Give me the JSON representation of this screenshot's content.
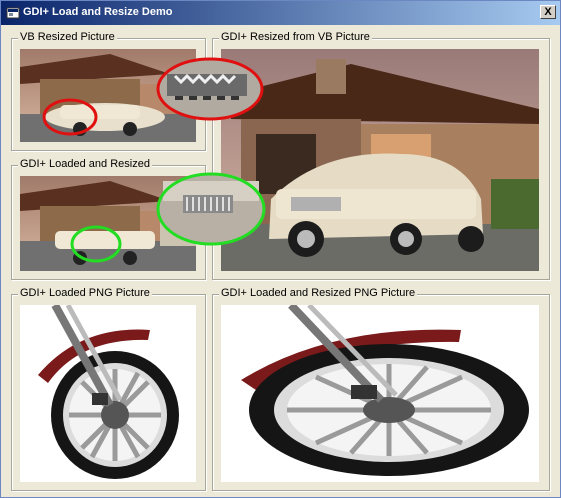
{
  "window": {
    "title": "GDI+ Load and Resize Demo",
    "close_label": "X"
  },
  "frames": {
    "vb_resized": {
      "label": "VB Resized Picture"
    },
    "gdi_from_vb": {
      "label": "GDI+ Resized from VB Picture"
    },
    "gdi_loaded_resized": {
      "label": "GDI+ Loaded and Resized"
    },
    "gdi_png": {
      "label": "GDI+ Loaded PNG Picture"
    },
    "gdi_png_resized": {
      "label": "GDI+ Loaded and Resized PNG Picture"
    }
  },
  "colors": {
    "highlight_red": "#e01010",
    "highlight_green": "#22dd22"
  },
  "icons": [
    "app-icon",
    "close-icon"
  ]
}
